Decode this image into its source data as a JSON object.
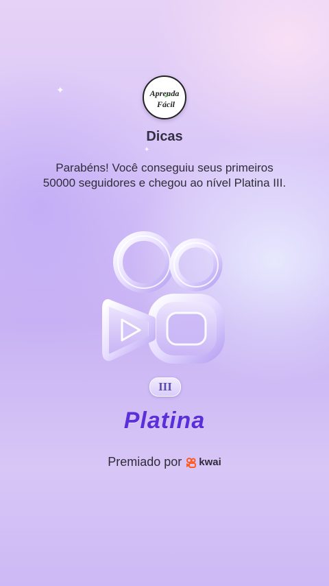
{
  "logo": {
    "line1": "Aprenda",
    "line2": "Fácil"
  },
  "dialog": {
    "title": "Dicas",
    "message": "Parabéns! Você conseguiu seus primeiros 50000 seguidores e chegou ao nível Platina III."
  },
  "badge": {
    "icon": "kwai-camera-icon",
    "level_numeral": "III",
    "level_name": "Platina"
  },
  "footer": {
    "awarded_by_label": "Premiado por",
    "brand_name": "kwai",
    "brand_icon": "kwai-logo-icon",
    "brand_color": "#ff5a1f"
  },
  "colors": {
    "accent": "#5a2ed8",
    "background": "#d8c6f8"
  }
}
